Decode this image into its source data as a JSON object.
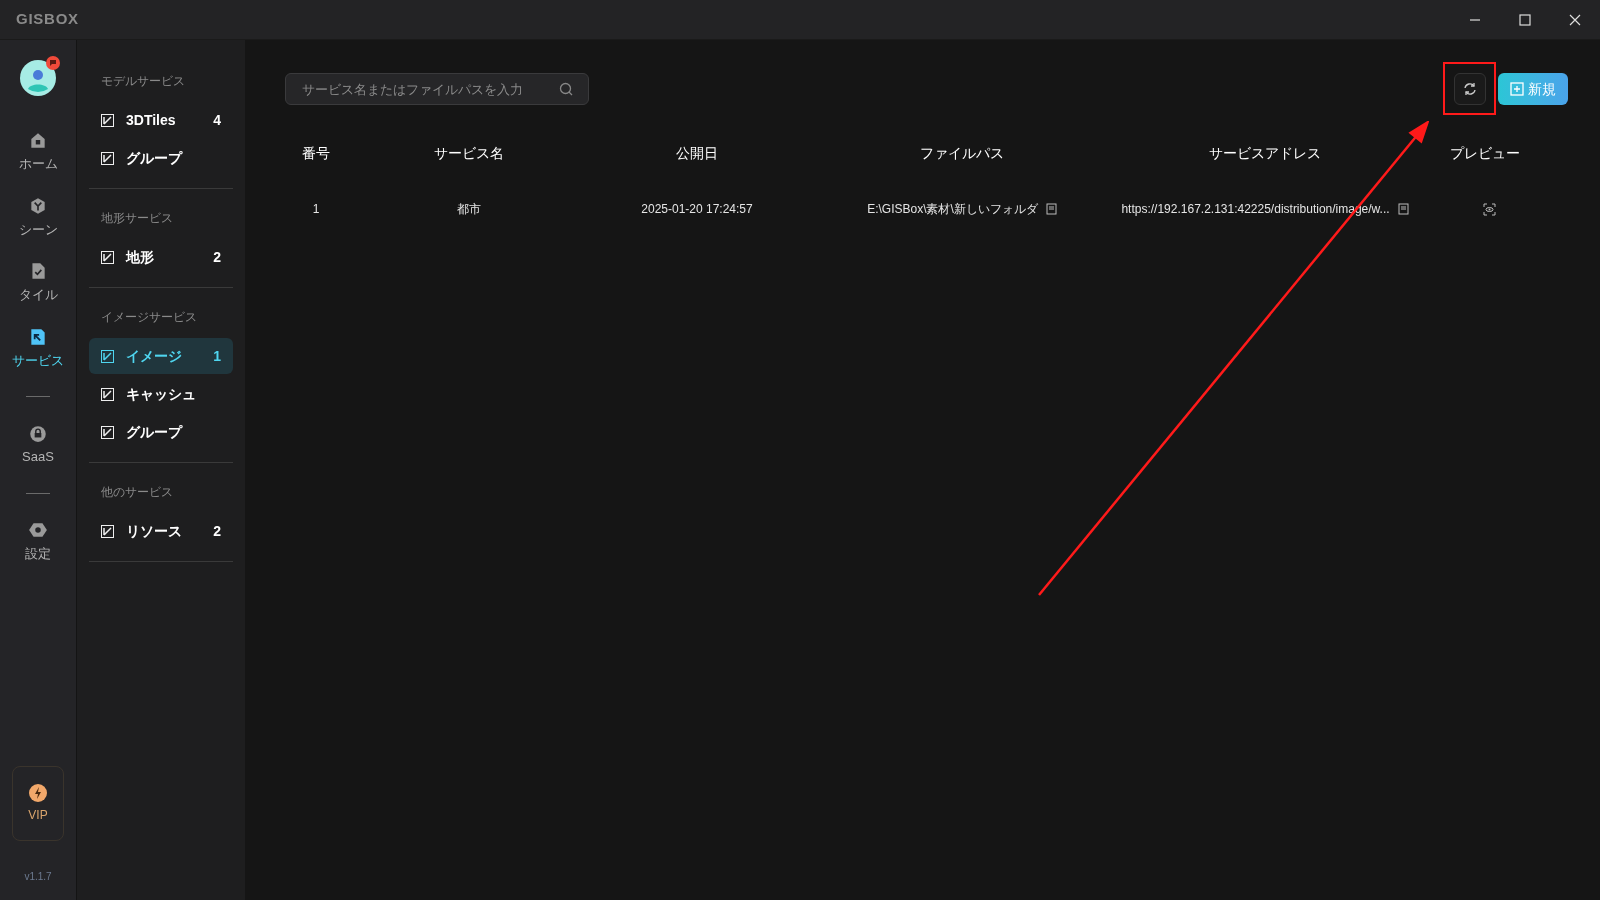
{
  "app": {
    "logo": "GISBOX"
  },
  "rail": [
    {
      "kind": "avatar"
    },
    {
      "kind": "nav",
      "label": "ホーム",
      "selected": false
    },
    {
      "kind": "nav",
      "label": "シーン",
      "selected": false
    },
    {
      "kind": "nav",
      "label": "タイル",
      "selected": false
    },
    {
      "kind": "nav",
      "label": "サービス",
      "selected": true
    },
    {
      "kind": "divider"
    },
    {
      "kind": "nav",
      "label": "SaaS",
      "selected": false
    },
    {
      "kind": "divider"
    },
    {
      "kind": "nav",
      "label": "設定",
      "selected": false
    }
  ],
  "vip": {
    "label": "VIP"
  },
  "version": "v1.1.7",
  "sidebar": [
    {
      "title": "モデルサービス",
      "items": [
        {
          "label": "3DTiles",
          "count": "4",
          "selected": false
        },
        {
          "label": "グループ",
          "selected": false
        }
      ]
    },
    {
      "title": "地形サービス",
      "items": [
        {
          "label": "地形",
          "count": "2",
          "selected": false
        }
      ]
    },
    {
      "title": "イメージサービス",
      "items": [
        {
          "label": "イメージ",
          "count": "1",
          "selected": true
        },
        {
          "label": "キャッシュ",
          "selected": false
        },
        {
          "label": "グループ",
          "selected": false
        }
      ]
    },
    {
      "title": "他のサービス",
      "items": [
        {
          "label": "リソース",
          "count": "2",
          "selected": false
        }
      ]
    }
  ],
  "search": {
    "placeholder": "サービス名またはファイルパスを入力"
  },
  "new_button": "新規",
  "table": {
    "columns": [
      "番号",
      "サービス名",
      "公開日",
      "ファイルパス",
      "サービスアドレス",
      "プレビュー"
    ],
    "rows": [
      {
        "number": "1",
        "name": "都市",
        "date": "2025-01-20 17:24:57",
        "path": "E:\\GISBox\\素材\\新しいフォルダ",
        "address": "https://192.167.2.131:42225/distribution/image/w..."
      }
    ]
  }
}
